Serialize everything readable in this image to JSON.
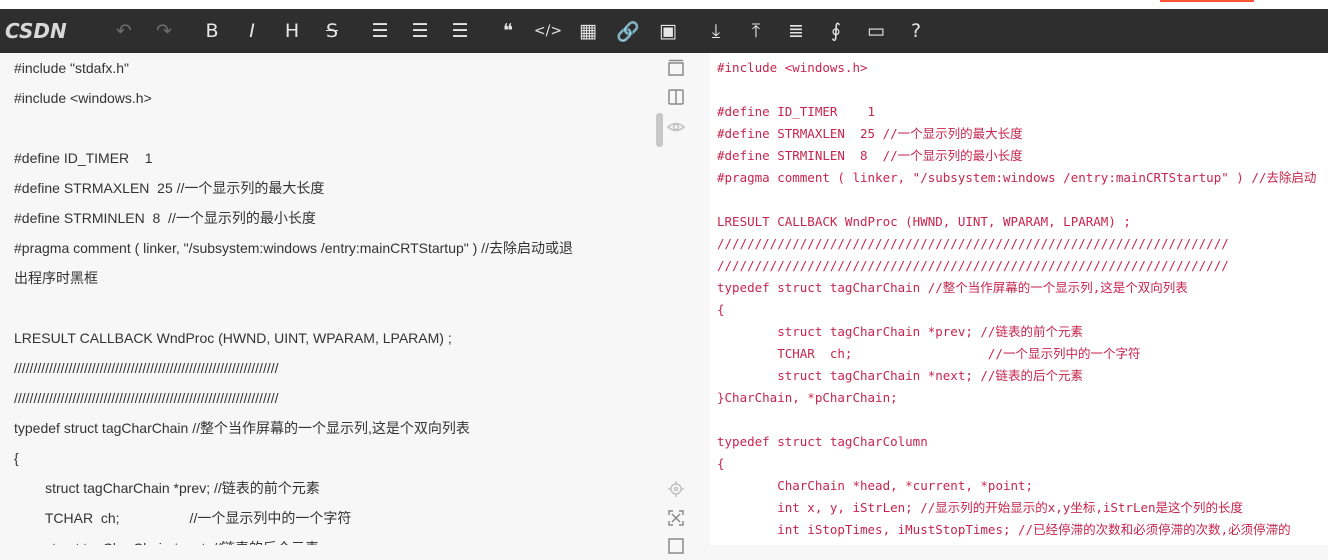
{
  "app": {
    "logo": "CSDN",
    "accent": "#fc5531"
  },
  "toolbar": {
    "buttons": [
      {
        "name": "undo",
        "icon": "undo-icon",
        "glyph": "↶",
        "enabled": false
      },
      {
        "name": "redo",
        "icon": "redo-icon",
        "glyph": "↷",
        "enabled": false
      },
      {
        "name": "bold",
        "icon": "bold-icon",
        "glyph": "B",
        "enabled": true
      },
      {
        "name": "italic",
        "icon": "italic-icon",
        "glyph": "I",
        "enabled": true
      },
      {
        "name": "heading",
        "icon": "heading-icon",
        "glyph": "H",
        "enabled": true
      },
      {
        "name": "strikethrough",
        "icon": "strikethrough-icon",
        "glyph": "S",
        "enabled": true
      },
      {
        "name": "unordered-list",
        "icon": "unordered-list-icon",
        "glyph": "☰",
        "enabled": true
      },
      {
        "name": "ordered-list",
        "icon": "ordered-list-icon",
        "glyph": "☰",
        "enabled": true
      },
      {
        "name": "task-list",
        "icon": "task-list-icon",
        "glyph": "☰",
        "enabled": true
      },
      {
        "name": "quote",
        "icon": "quote-icon",
        "glyph": "❝",
        "enabled": true
      },
      {
        "name": "code",
        "icon": "code-icon",
        "glyph": "</>",
        "enabled": true
      },
      {
        "name": "table",
        "icon": "table-icon",
        "glyph": "▦",
        "enabled": true
      },
      {
        "name": "link",
        "icon": "link-icon",
        "glyph": "🔗",
        "enabled": true
      },
      {
        "name": "image",
        "icon": "image-icon",
        "glyph": "▣",
        "enabled": true
      },
      {
        "name": "import",
        "icon": "import-icon",
        "glyph": "⤓",
        "enabled": true
      },
      {
        "name": "export",
        "icon": "export-icon",
        "glyph": "⤒",
        "enabled": true
      },
      {
        "name": "toc",
        "icon": "toc-icon",
        "glyph": "≣",
        "enabled": true
      },
      {
        "name": "formula",
        "icon": "formula-icon",
        "glyph": "∮",
        "enabled": true
      },
      {
        "name": "save",
        "icon": "save-icon",
        "glyph": "▭",
        "enabled": true
      },
      {
        "name": "help",
        "icon": "help-icon",
        "glyph": "?",
        "enabled": true
      }
    ]
  },
  "editor": {
    "lines": [
      "#include \"stdafx.h\"",
      "#include <windows.h>",
      "",
      "#define ID_TIMER    1",
      "#define STRMAXLEN  25 //一个显示列的最大长度",
      "#define STRMINLEN  8  //一个显示列的最小长度",
      "#pragma comment ( linker, \"/subsystem:windows /entry:mainCRTStartup\" ) //去除启动或退",
      "出程序时黑框",
      "",
      "LRESULT CALLBACK WndProc (HWND, UINT, WPARAM, LPARAM) ;",
      "////////////////////////////////////////////////////////////////////",
      "////////////////////////////////////////////////////////////////////",
      "typedef struct tagCharChain //整个当作屏幕的一个显示列,这是个双向列表",
      "{",
      "        struct tagCharChain *prev; //链表的前个元素",
      "        TCHAR  ch;                  //一个显示列中的一个字符",
      "        struct tagCharChain *next; //链表的后个元素"
    ]
  },
  "side_tools": [
    {
      "name": "sync-scroll",
      "icon": "sync-scroll-icon"
    },
    {
      "name": "split-view",
      "icon": "split-view-icon"
    },
    {
      "name": "preview-toggle",
      "icon": "eye-icon"
    },
    {
      "name": "locate",
      "icon": "locate-icon"
    },
    {
      "name": "fullscreen",
      "icon": "fullscreen-icon"
    },
    {
      "name": "more",
      "icon": "panel-icon"
    }
  ],
  "preview": {
    "lines": [
      "#include \"stdafx.h\"",
      "#include <windows.h>",
      "",
      "#define ID_TIMER    1",
      "#define STRMAXLEN  25 //一个显示列的最大长度",
      "#define STRMINLEN  8  //一个显示列的最小长度",
      "#pragma comment ( linker, \"/subsystem:windows /entry:mainCRTStartup\" ) //去除启动",
      "",
      "LRESULT CALLBACK WndProc (HWND, UINT, WPARAM, LPARAM) ;",
      "////////////////////////////////////////////////////////////////////",
      "////////////////////////////////////////////////////////////////////",
      "typedef struct tagCharChain //整个当作屏幕的一个显示列,这是个双向列表",
      "{",
      "        struct tagCharChain *prev; //链表的前个元素",
      "        TCHAR  ch;                  //一个显示列中的一个字符",
      "        struct tagCharChain *next; //链表的后个元素",
      "}CharChain, *pCharChain;",
      "",
      "typedef struct tagCharColumn",
      "{",
      "        CharChain *head, *current, *point;",
      "        int x, y, iStrLen; //显示列的开始显示的x,y坐标,iStrLen是这个列的长度",
      "        int iStopTimes, iMustStopTimes; //已经停滞的次数和必须停滞的次数,必须停滞的"
    ]
  }
}
